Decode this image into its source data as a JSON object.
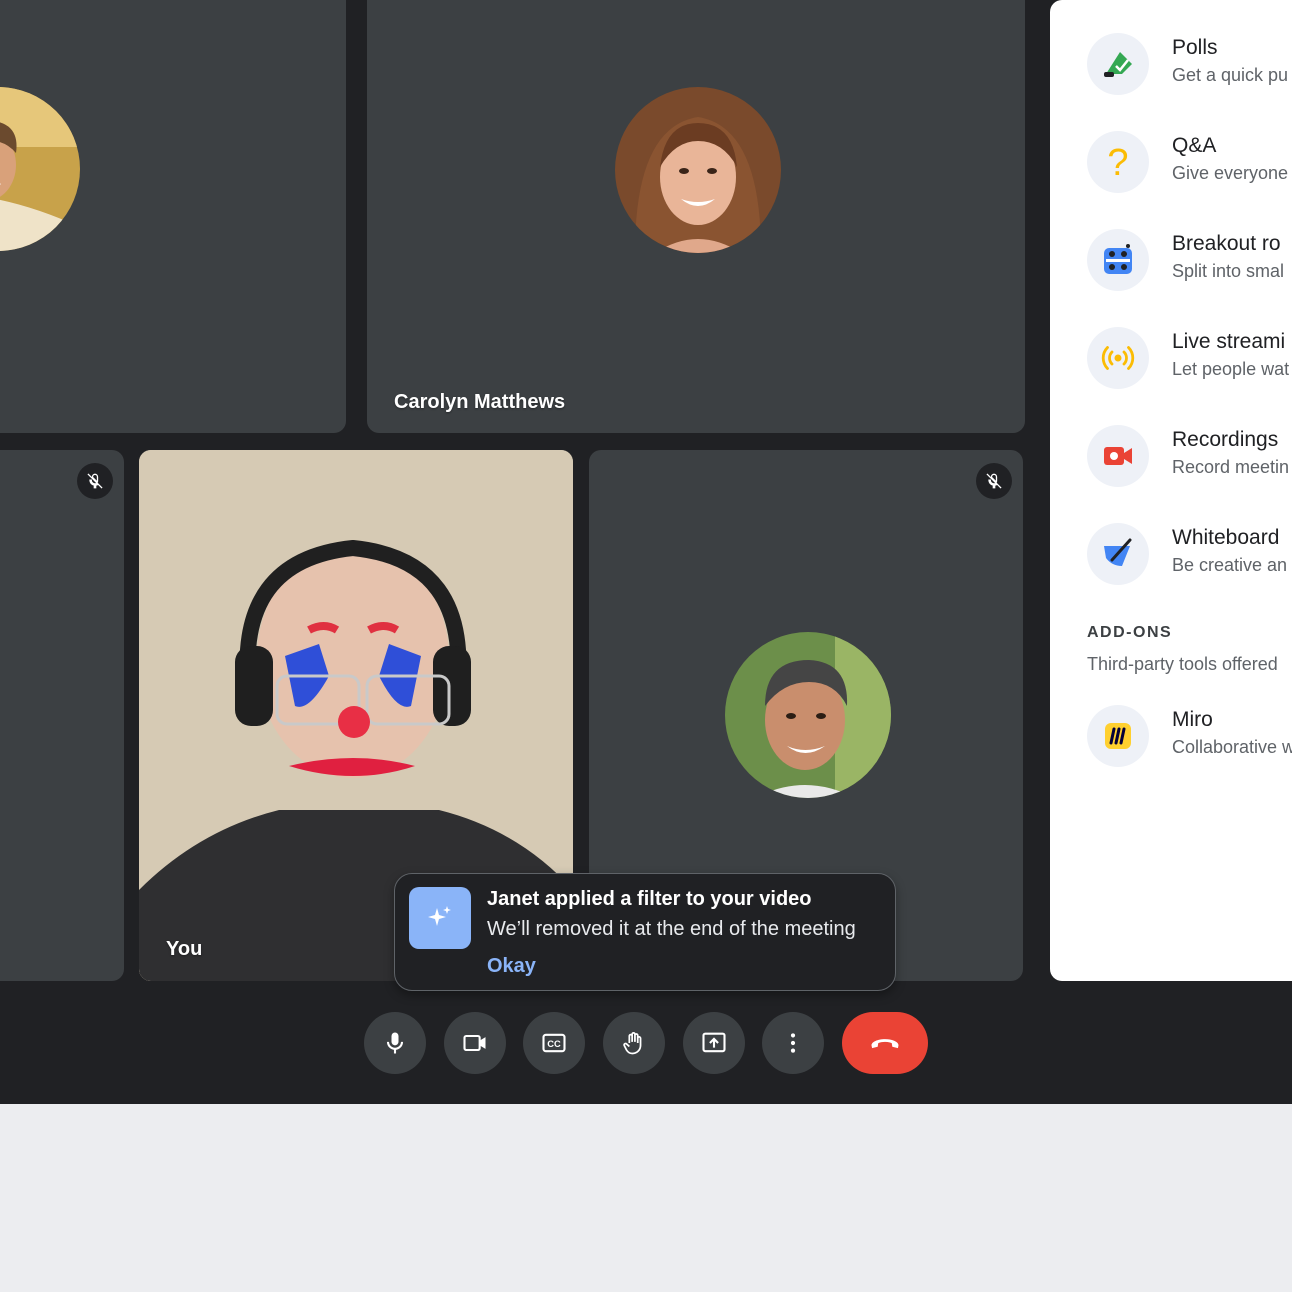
{
  "participants": {
    "top_left": {
      "name": ""
    },
    "top_right": {
      "name": "Carolyn Matthews"
    },
    "you": {
      "name": "You"
    },
    "bottom_right": {
      "name": ""
    }
  },
  "toast": {
    "title": "Janet applied a filter to your video",
    "body": "We’ll removed it at the end of the meeting",
    "action": "Okay",
    "icon": "sparkle-icon",
    "icon_bg": "#8ab4f8"
  },
  "controls": [
    {
      "name": "microphone",
      "icon": "microphone-icon"
    },
    {
      "name": "camera",
      "icon": "camera-icon"
    },
    {
      "name": "captions",
      "icon": "captions-icon"
    },
    {
      "name": "raise-hand",
      "icon": "hand-icon"
    },
    {
      "name": "present",
      "icon": "present-icon"
    },
    {
      "name": "more-options",
      "icon": "more-vert-icon"
    },
    {
      "name": "end-call",
      "icon": "hang-up-icon",
      "color": "#ea4335"
    }
  ],
  "activities": [
    {
      "title": "Polls",
      "desc": "Get a quick pu",
      "icon": "polls-icon"
    },
    {
      "title": "Q&A",
      "desc": "Give everyone",
      "icon": "qa-icon"
    },
    {
      "title": "Breakout ro",
      "desc": "Split into smal",
      "icon": "breakout-icon"
    },
    {
      "title": "Live streami",
      "desc": "Let people wat",
      "icon": "live-stream-icon"
    },
    {
      "title": "Recordings",
      "desc": "Record meetin",
      "icon": "recordings-icon"
    },
    {
      "title": "Whiteboard",
      "desc": "Be creative an",
      "icon": "whiteboard-icon"
    }
  ],
  "addons": {
    "heading": "ADD-ONS",
    "desc": "Third-party tools offered",
    "items": [
      {
        "title": "Miro",
        "desc": "Collaborative w",
        "icon": "miro-icon",
        "color": "#ffd02f"
      }
    ]
  },
  "colors": {
    "background": "#202124",
    "tile": "#3c4043",
    "accent": "#8ab4f8",
    "danger": "#ea4335"
  }
}
